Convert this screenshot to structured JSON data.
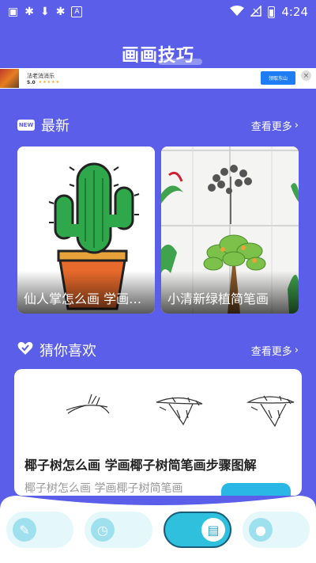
{
  "status_bar": {
    "time": "4:24",
    "left_icons": [
      "image-icon",
      "bug-icon",
      "download-icon",
      "bug-icon",
      "font-icon"
    ],
    "right_icons": [
      "wifi-icon",
      "no-signal-icon",
      "battery-charging-icon"
    ]
  },
  "header": {
    "title": "画画技巧"
  },
  "ad": {
    "app_name": "法老消消乐",
    "rating": "5.0",
    "cta": "领取东山"
  },
  "latest": {
    "title": "最新",
    "badge": "NEW",
    "more": "查看更多",
    "cards": [
      {
        "caption": "仙人掌怎么画 学画仙人掌简笔画"
      },
      {
        "caption": "小清新绿植简笔画"
      }
    ]
  },
  "recommend": {
    "title": "猜你喜欢",
    "more": "查看更多",
    "item": {
      "title": "椰子树怎么画 学画椰子树简笔画步骤图解",
      "subtitle": "椰子树怎么画 学画椰子树简笔画"
    }
  },
  "bottom_nav": {
    "items": [
      {
        "icon": "brush-icon",
        "active": false
      },
      {
        "icon": "clock-icon",
        "active": false
      },
      {
        "icon": "book-icon",
        "active": true
      },
      {
        "icon": "user-icon",
        "active": false
      }
    ]
  },
  "colors": {
    "background": "#5a5ee8",
    "accent": "#2fc0dd",
    "nav_bg": "#ffffff"
  }
}
